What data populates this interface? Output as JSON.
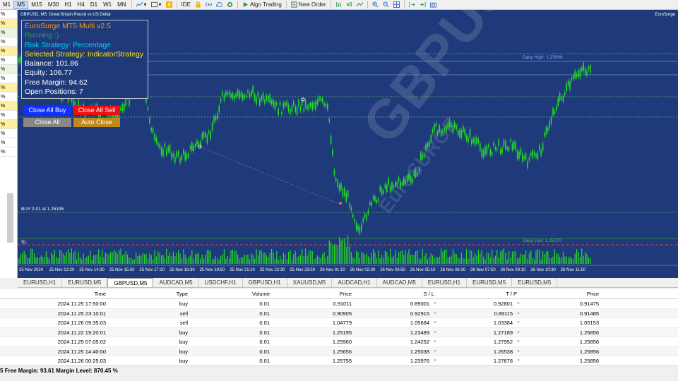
{
  "toolbar": {
    "timeframes": [
      "M1",
      "M5",
      "M15",
      "M30",
      "H1",
      "H4",
      "D1",
      "W1",
      "MN"
    ],
    "active_timeframe": "M5",
    "ide_label": "IDE",
    "algo_trading_label": "Algo Trading",
    "new_order_label": "New Order"
  },
  "left_panel": {
    "cells": [
      "%",
      "%",
      "%",
      "%",
      "%",
      "%",
      "%",
      "%",
      "%",
      "%",
      "%",
      "%",
      "%",
      "%",
      "%",
      "%"
    ]
  },
  "chart": {
    "title": "GBPUSD, M5:  Great Britain Pound vs US Dollar",
    "corner_label": "EuroSurge",
    "daily_high_label": "Daily High: 1.25908",
    "daily_low_label": "Daily Low: 1.25070",
    "buy_label": "BUY 0.01 at 1.25195",
    "sl_label": "SL",
    "time_labels": [
      "25 Nov 2024",
      "25 Nov 13:20",
      "25 Nov 14:30",
      "25 Nov 15:50",
      "25 Nov 17:10",
      "25 Nov 18:30",
      "25 Nov 19:50",
      "25 Nov 21:10",
      "25 Nov 22:30",
      "25 Nov 23:50",
      "26 Nov 01:10",
      "26 Nov 02:30",
      "26 Nov 03:50",
      "26 Nov 05:10",
      "26 Nov 06:30",
      "26 Nov 07:50",
      "26 Nov 09:10",
      "26 Nov 10:30",
      "26 Nov 11:50"
    ],
    "watermark_main": "GBPUSD",
    "watermark_small": "EuroSURGE",
    "colors": {
      "background": "#1f3a7a",
      "candle": "#21e021",
      "level_line": "#5fbf5f",
      "sl_line": "#e04040"
    }
  },
  "ea_panel": {
    "title": "EuroSurge MT5 Multi v2.5",
    "status": "Running :)",
    "risk_strategy": "Risk Strategy: Percentage",
    "selected_strategy": "Selected Strategy: IndicatorStrategy",
    "balance": "Balance: 101.86",
    "equity": "Equity: 106.77",
    "free_margin": "Free Margin: 94.62",
    "open_positions": "Open Positions: 7",
    "colors": {
      "title": "#ff9900",
      "status": "#2ea043",
      "risk": "#00d7ff",
      "selected": "#ffe500",
      "stats": "#ffffff"
    }
  },
  "buttons": {
    "close_all_buy": "Close All Buy",
    "close_all_sell": "Close All Sell",
    "close_all": "Close All",
    "auto_close": "Auto Close"
  },
  "tabs": [
    "EURUSD,H1",
    "EURUSD,M5",
    "GBPUSD,M5",
    "AUDCAD,M5",
    "USDCHF,H1",
    "GBPUSD,H1",
    "XAUUSD,M5",
    "AUDCAD,H1",
    "AUDCAD,M5",
    "EURUSD,H1",
    "EURUSD,M5",
    "EURUSD,M5"
  ],
  "active_tab": "GBPUSD,M5",
  "table": {
    "headers": [
      "Time",
      "Type",
      "Volume",
      "Price",
      "S / L",
      "T / P",
      "Price"
    ],
    "rows": [
      [
        "2024.11.25 17:50:00",
        "buy",
        "0.01",
        "0.91011",
        "0.89001",
        "0.92801",
        "0.91475"
      ],
      [
        "2024.11.25 23:10:01",
        "sell",
        "0.01",
        "0.90905",
        "0.92915",
        "0.89115",
        "0.91485"
      ],
      [
        "2024.11.26 09:35:03",
        "sell",
        "0.01",
        "1.04779",
        "1.05684",
        "1.03384",
        "1.05153"
      ],
      [
        "2024.11.22 19:20:01",
        "buy",
        "0.01",
        "1.25195",
        "1.23489",
        "1.27189",
        "1.25856"
      ],
      [
        "2024.11.25 07:05:02",
        "buy",
        "0.01",
        "1.25960",
        "1.24252",
        "1.27952",
        "1.25856"
      ],
      [
        "2024.11.25 14:40:00",
        "buy",
        "0.01",
        "1.25656",
        "1.25038",
        "1.26538",
        "1.25856"
      ],
      [
        "2024.11.26 00:25:03",
        "buy",
        "0.01",
        "1.25755",
        "1.23976",
        "1.27676",
        "1.25856"
      ]
    ]
  },
  "status_bar": {
    "text": "5  Free Margin: 93.61  Margin Level: 870.45 %"
  }
}
